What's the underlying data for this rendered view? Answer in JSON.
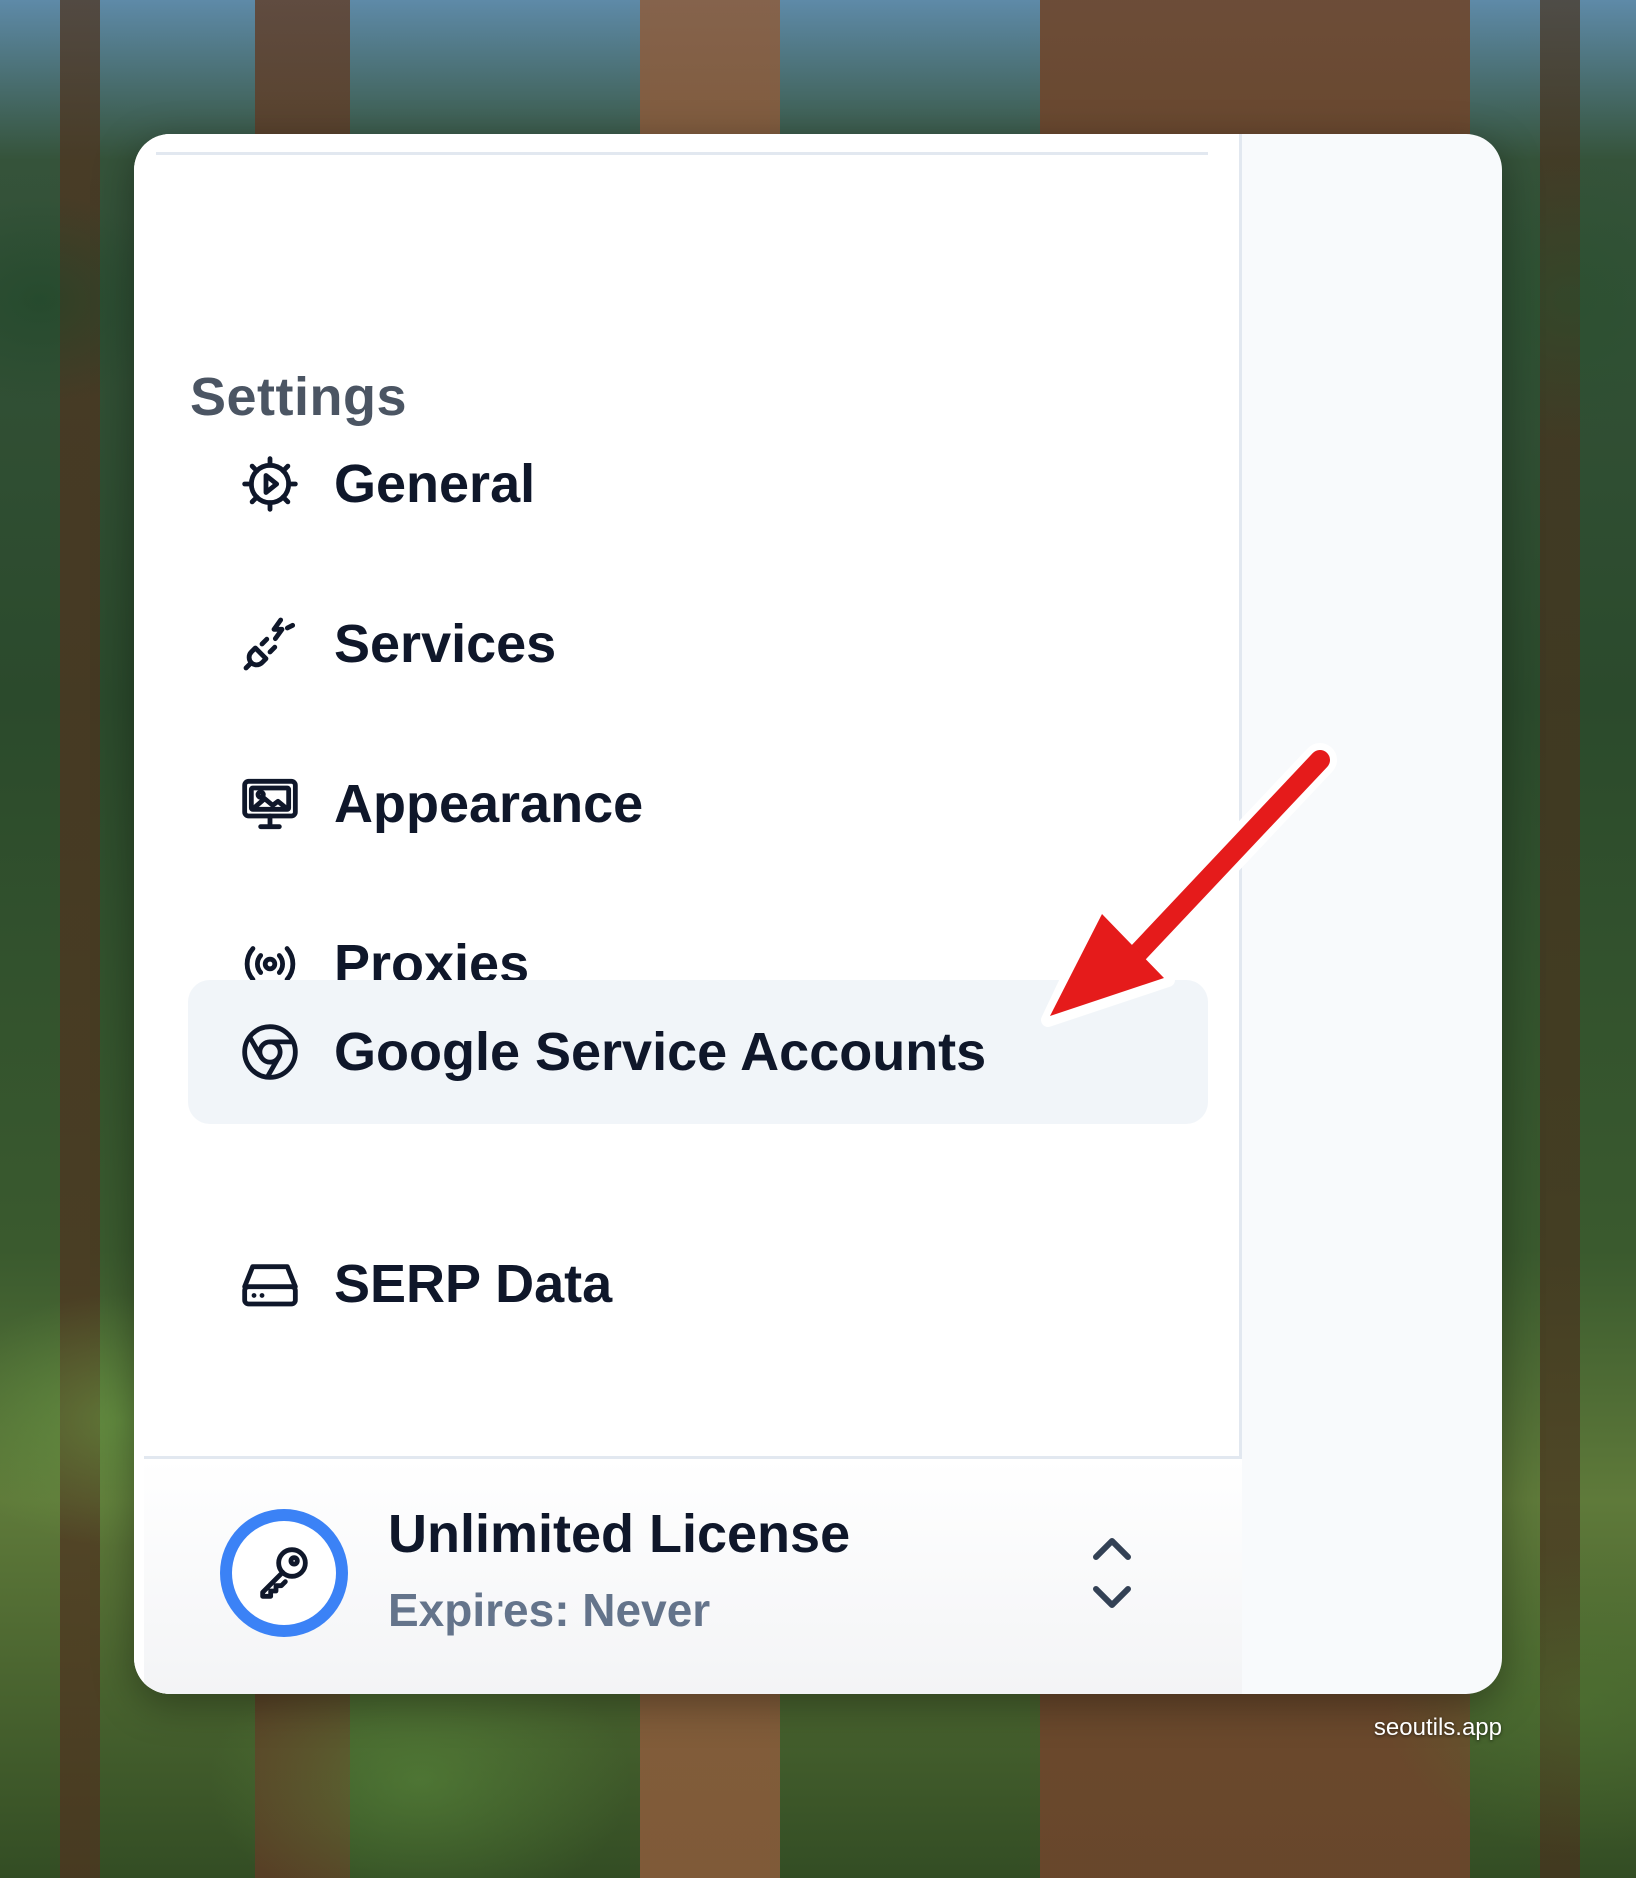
{
  "sidebar": {
    "section_title": "Settings",
    "items": [
      {
        "label": "General",
        "icon": "gear-icon",
        "active": false
      },
      {
        "label": "Services",
        "icon": "plug-icon",
        "active": false
      },
      {
        "label": "Appearance",
        "icon": "monitor-image-icon",
        "active": false
      },
      {
        "label": "Proxies",
        "icon": "broadcast-icon",
        "active": false
      },
      {
        "label": "Google Service Accounts",
        "icon": "chrome-icon",
        "active": true
      },
      {
        "label": "SERP Data",
        "icon": "hard-drive-icon",
        "active": false
      }
    ]
  },
  "license": {
    "name": "Unlimited License",
    "expiry": "Expires: Never",
    "icon": "key-icon",
    "accent": "#3b82f6"
  },
  "annotation": {
    "icon": "red-arrow",
    "color": "#e51b1b"
  },
  "watermark": "seoutils.app"
}
